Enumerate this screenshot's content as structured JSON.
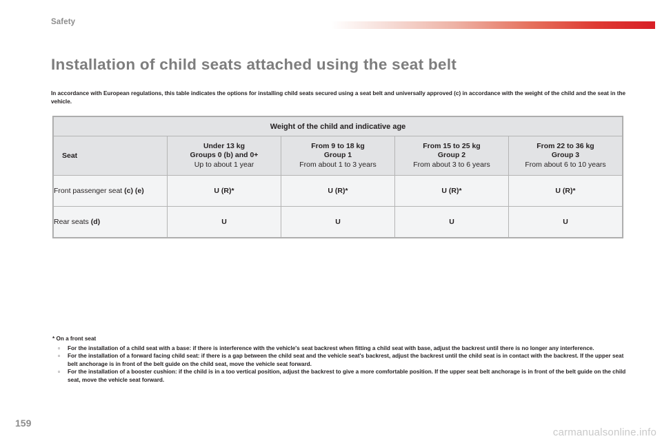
{
  "header": {
    "section_label": "Safety",
    "gradient_from": "#ffffff",
    "gradient_to": "#d81f26"
  },
  "title": "Installation of child seats attached using the seat belt",
  "intro": "In accordance with European regulations, this table indicates the options for installing child seats secured using a seat belt and universally approved (c) in accordance with the weight of the child and the seat in the vehicle.",
  "table": {
    "top_header": "Weight of the child and indicative age",
    "seat_column_header": "Seat",
    "columns": [
      {
        "weight": "Under 13 kg",
        "group": "Groups 0 (b) and 0+",
        "age": "Up to about 1 year"
      },
      {
        "weight": "From 9 to 18 kg",
        "group": "Group 1",
        "age": "From about 1 to 3 years"
      },
      {
        "weight": "From 15 to 25 kg",
        "group": "Group 2",
        "age": "From about 3 to 6 years"
      },
      {
        "weight": "From 22 to 36 kg",
        "group": "Group 3",
        "age": "From about 6 to 10 years"
      }
    ],
    "rows": [
      {
        "label_text": "Front passenger seat ",
        "label_bold": "(c) (e)",
        "values": [
          "U (R)*",
          "U (R)*",
          "U (R)*",
          "U (R)*"
        ]
      },
      {
        "label_text": "Rear seats ",
        "label_bold": "(d)",
        "values": [
          "U",
          "U",
          "U",
          "U"
        ]
      }
    ]
  },
  "footnotes": {
    "title": "* On a front seat",
    "items": [
      "For the installation of a child seat with a base: if there is interference with the vehicle's seat backrest when fitting a child seat with base, adjust the backrest until there is no longer any interference.",
      "For the installation of a forward facing child seat: if there is a gap between the child seat and the vehicle seat's backrest, adjust the backrest until the child seat is in contact with the backrest. If the upper seat belt anchorage is in front of the belt guide on the child seat, move the vehicle seat forward.",
      "For the installation of a booster cushion: if the child is in a too vertical position, adjust the backrest to give a more comfortable position. If the upper seat belt anchorage is in front of the belt guide on the child seat, move the vehicle seat forward."
    ],
    "bullet_glyph": "▫"
  },
  "footer": {
    "page_number": "159",
    "watermark": "carmanualsonline.info"
  }
}
